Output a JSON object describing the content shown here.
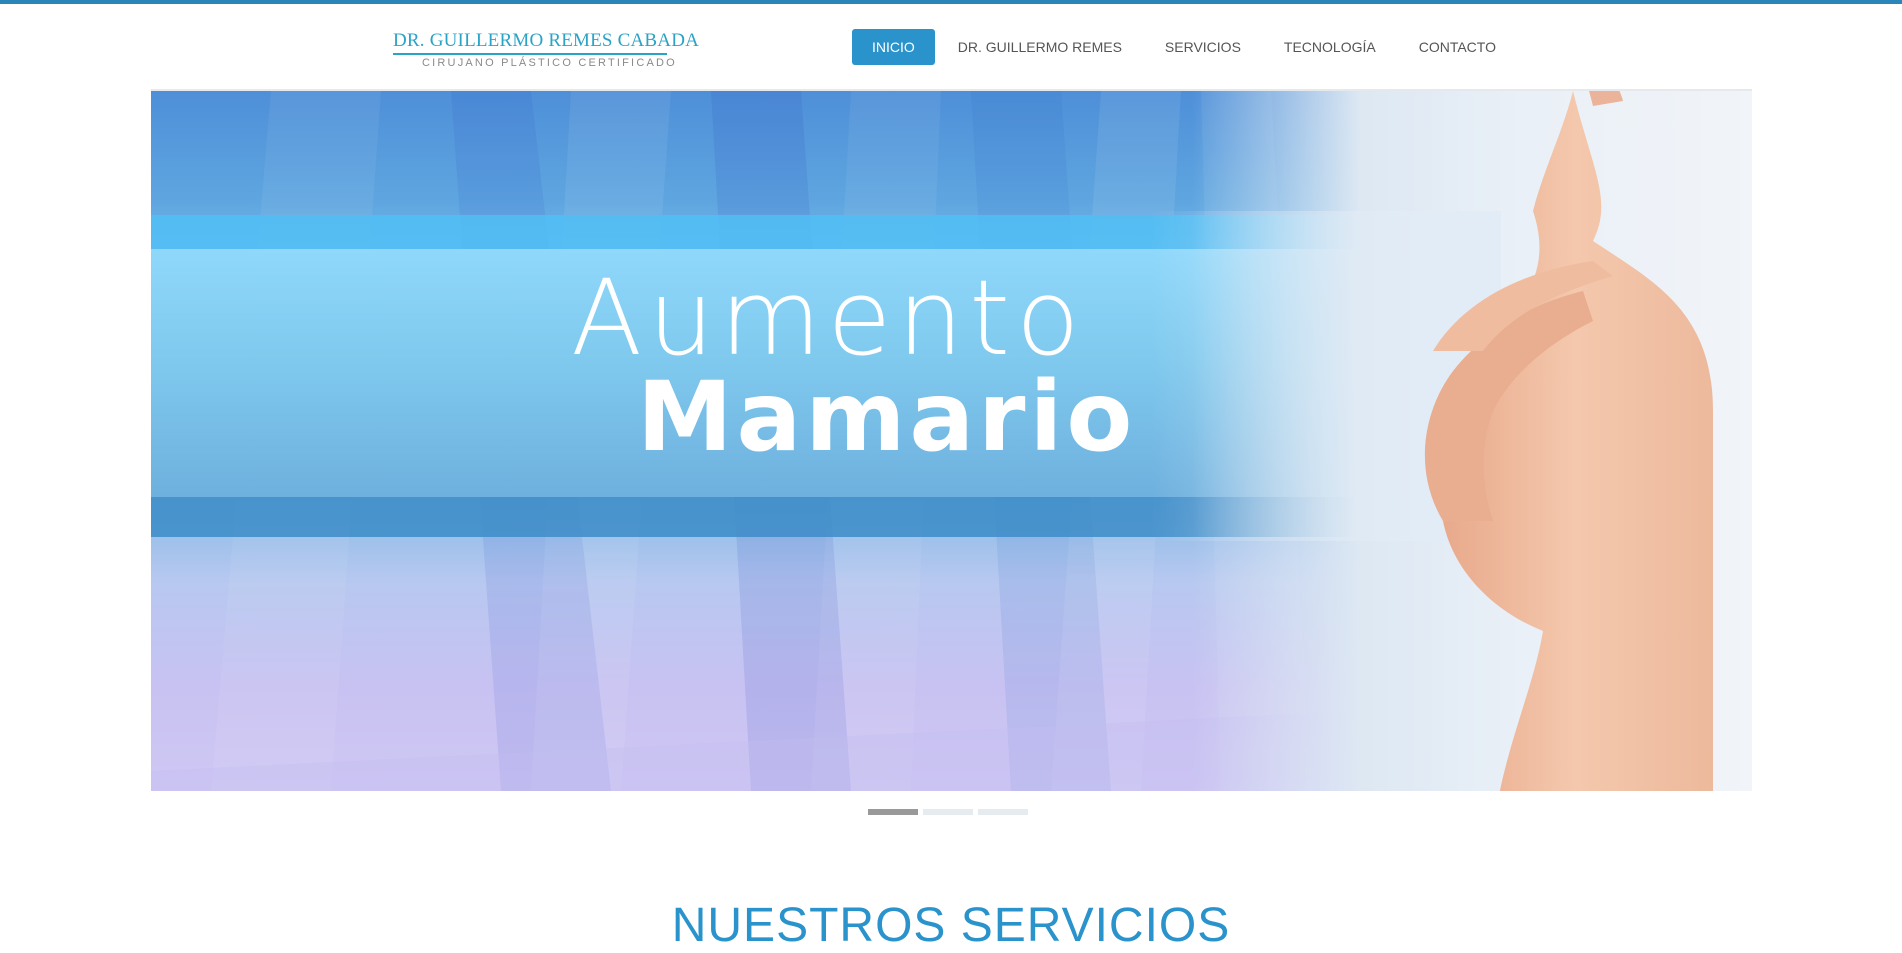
{
  "header": {
    "logo": {
      "name": "DR. GUILLERMO REMES CABADA",
      "tagline": "CIRUJANO PLÁSTICO CERTIFICADO"
    },
    "nav": [
      {
        "label": "INICIO",
        "active": true
      },
      {
        "label": "DR. GUILLERMO REMES",
        "active": false
      },
      {
        "label": "SERVICIOS",
        "active": false
      },
      {
        "label": "TECNOLOGÍA",
        "active": false
      },
      {
        "label": "CONTACTO",
        "active": false
      }
    ]
  },
  "hero": {
    "line1": "Aumento",
    "line2": "Mamario",
    "slides": 3,
    "active_slide": 1
  },
  "sections": {
    "services_title": "NUESTROS SERVICIOS"
  },
  "colors": {
    "accent": "#2a93cc",
    "logo": "#2aa3c6",
    "nav_text": "#555555"
  }
}
